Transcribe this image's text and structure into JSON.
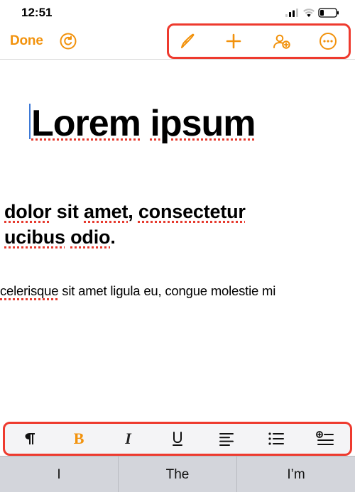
{
  "status": {
    "time": "12:51"
  },
  "toolbar": {
    "done_label": "Done"
  },
  "doc": {
    "title_w1": "Lorem",
    "title_w2": "ipsum",
    "p1_w1": "dolor",
    "p1_plain1": " sit ",
    "p1_w2": "amet",
    "p1_plain2": ", ",
    "p1_w3": "consectetur",
    "p1_line2_w1": "ucibus",
    "p1_line2_w2": "odio",
    "p2_w1": "celerisque",
    "p2_rest": "sit amet ligula eu, congue molestie mi"
  },
  "predictive": {
    "a": "I",
    "b": "The",
    "c": "I’m"
  },
  "colors": {
    "accent": "#f2920c",
    "highlight_border": "#ee3a2e"
  }
}
